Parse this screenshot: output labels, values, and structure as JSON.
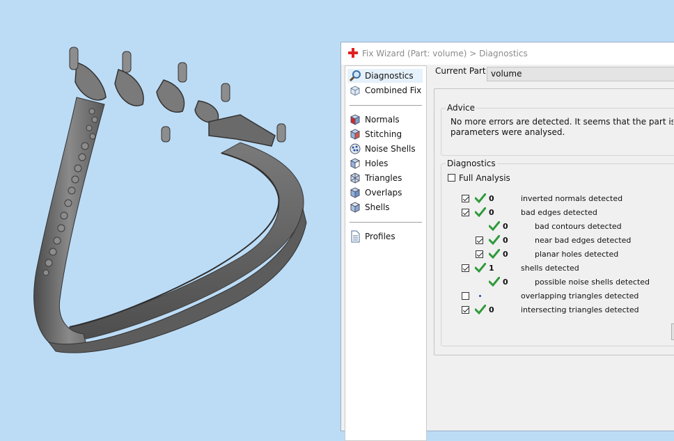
{
  "window": {
    "title": "Fix Wizard (Part: volume) > Diagnostics"
  },
  "nav": {
    "items": [
      {
        "label": "Diagnostics",
        "icon": "magnifier-icon",
        "active": true
      },
      {
        "label": "Combined Fix",
        "icon": "cube-stack-icon"
      },
      {
        "label": "Normals",
        "icon": "cube-red-face-icon"
      },
      {
        "label": "Stitching",
        "icon": "cube-blue-icon"
      },
      {
        "label": "Noise Shells",
        "icon": "noise-shells-icon"
      },
      {
        "label": "Holes",
        "icon": "cube-hole-icon"
      },
      {
        "label": "Triangles",
        "icon": "cube-triangles-icon"
      },
      {
        "label": "Overlaps",
        "icon": "cube-overlap-icon"
      },
      {
        "label": "Shells",
        "icon": "cube-shells-icon"
      },
      {
        "label": "Profiles",
        "icon": "document-icon"
      }
    ]
  },
  "current_part": {
    "label": "Current Part:",
    "value": "volume"
  },
  "advice": {
    "title": "Advice",
    "line1": "No more errors are detected. It seems that the part is ok. Note t",
    "line2": "parameters were analysed."
  },
  "diagnostics": {
    "title": "Diagnostics",
    "full_analysis": {
      "label": "Full Analysis",
      "checked": false
    },
    "rows": [
      {
        "label": "inverted normals detected",
        "count": "0",
        "checked": true,
        "status": "ok"
      },
      {
        "label": "bad edges detected",
        "count": "0",
        "checked": true,
        "status": "ok"
      },
      {
        "label": "bad contours detected",
        "count": "0",
        "checked": null,
        "status": "ok"
      },
      {
        "label": "near bad edges detected",
        "count": "0",
        "checked": true,
        "status": "ok"
      },
      {
        "label": "planar holes detected",
        "count": "0",
        "checked": true,
        "status": "ok"
      },
      {
        "label": "shells detected",
        "count": "1",
        "checked": true,
        "status": "ok"
      },
      {
        "label": "possible noise shells detected",
        "count": "0",
        "checked": null,
        "status": "ok"
      },
      {
        "label": "overlapping triangles detected",
        "count": "",
        "checked": false,
        "status": "pending"
      },
      {
        "label": "intersecting triangles detected",
        "count": "0",
        "checked": true,
        "status": "ok"
      }
    ]
  },
  "colors": {
    "viewport": "#bcdcf6",
    "check": "#2f9a3a",
    "selection": "#e5f1fb"
  }
}
